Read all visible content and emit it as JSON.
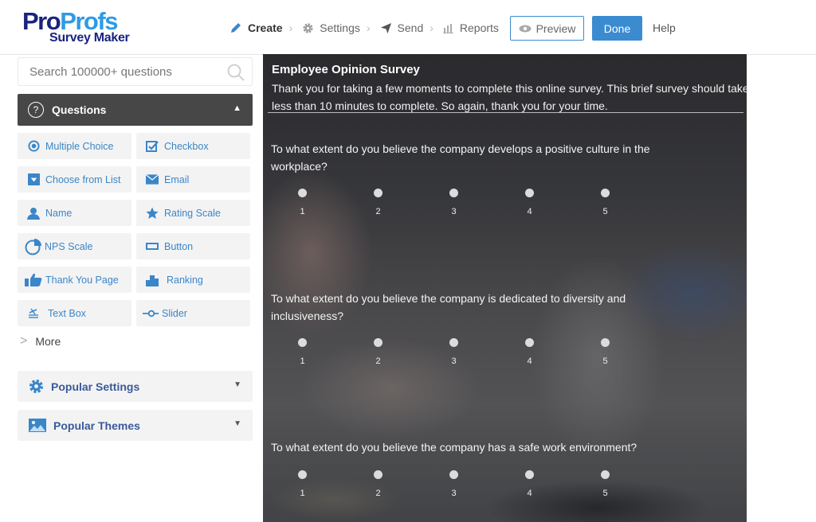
{
  "header": {
    "logo": {
      "pro": "Pro",
      "profs": "Profs",
      "subtitle": "Survey Maker"
    },
    "nav": [
      {
        "label": "Create",
        "icon": "pencil-icon",
        "active": true
      },
      {
        "label": "Settings",
        "icon": "gear-icon",
        "active": false
      },
      {
        "label": "Send",
        "icon": "paper-plane-icon",
        "active": false
      },
      {
        "label": "Reports",
        "icon": "bar-chart-icon",
        "active": false
      }
    ],
    "preview_label": "Preview",
    "done_label": "Done",
    "help_label": "Help"
  },
  "sidebar": {
    "search_placeholder": "Search 100000+ questions",
    "questions_header": "Questions",
    "question_types": [
      {
        "label": "Multiple Choice",
        "icon": "radio-icon"
      },
      {
        "label": "Checkbox",
        "icon": "checkbox-icon"
      },
      {
        "label": "Choose from List",
        "icon": "dropdown-icon"
      },
      {
        "label": "Email",
        "icon": "envelope-icon"
      },
      {
        "label": "Name",
        "icon": "user-icon"
      },
      {
        "label": "Rating Scale",
        "icon": "star-icon"
      },
      {
        "label": "NPS Scale",
        "icon": "pie-chart-icon"
      },
      {
        "label": "Button",
        "icon": "button-icon"
      },
      {
        "label": "Thank You Page",
        "icon": "thumbs-up-icon"
      },
      {
        "label": "Ranking",
        "icon": "ranking-icon"
      },
      {
        "label": "Text Box",
        "icon": "text-box-icon"
      },
      {
        "label": "Slider",
        "icon": "slider-icon"
      }
    ],
    "more_label": "More",
    "popular_settings": "Popular Settings",
    "popular_themes": "Popular Themes"
  },
  "survey": {
    "title": "Employee Opinion Survey",
    "description": "Thank you for taking a few moments to complete this online survey.  This brief survey should take less than 10 minutes to complete. So again, thank you for your time.",
    "questions": [
      {
        "text": "To what extent do you believe the company develops a positive culture in the workplace?",
        "options": [
          "1",
          "2",
          "3",
          "4",
          "5"
        ]
      },
      {
        "text": "To what extent do you believe the company is dedicated to diversity and inclusiveness?",
        "options": [
          "1",
          "2",
          "3",
          "4",
          "5"
        ]
      },
      {
        "text": "To what extent do you believe the company has a safe work environment?",
        "options": [
          "1",
          "2",
          "3",
          "4",
          "5"
        ]
      }
    ]
  },
  "colors": {
    "accent": "#3b8bd1",
    "logo_dark": "#1a237e",
    "logo_light": "#2e9be6",
    "questions_header_bg": "#474747"
  }
}
